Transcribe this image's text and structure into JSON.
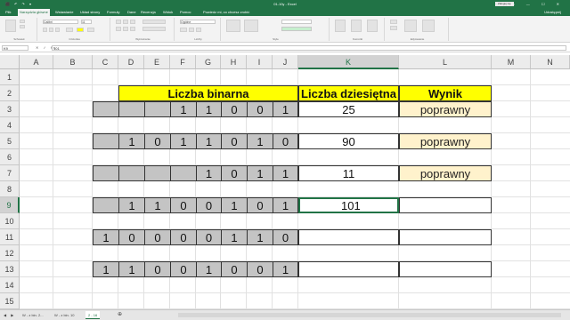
{
  "titlebar": {
    "qat": "⬛ ↶ ↷ ▾",
    "title": "01-10y - Excel",
    "signin": "Zaloguj się",
    "winbtns": "▭ — ☐ ✕"
  },
  "tabs": {
    "items": [
      "Plik",
      "Narzędzia główne",
      "Wstawianie",
      "Układ strony",
      "Formuły",
      "Dane",
      "Recenzja",
      "Widok",
      "Pomoc"
    ],
    "active_index": 1,
    "tellme": "Powiedz mi, co chcesz zrobić",
    "share": "Udostępnij"
  },
  "ribbon": {
    "groups": [
      "Schowek",
      "Czcionka",
      "Wyrównanie",
      "Liczby",
      "Style",
      "Komórki",
      "Edytowanie"
    ],
    "font_name": "Calibri",
    "font_size": "11",
    "number_format": "Ogólne",
    "cond_format": "Formatowanie warunkowe",
    "format_table": "Formatuj jako tabelę",
    "cell_styles": "Style komórki",
    "insert": "Wstaw",
    "delete": "Usuń",
    "format": "Format",
    "sum": "Σ",
    "sort": "Sortuj i filtruj",
    "find": "Znajdź i zaznacz"
  },
  "formula_bar": {
    "namebox": "K9",
    "fx": "✕ ✓ fx",
    "formula": "101"
  },
  "grid": {
    "columns": [
      "A",
      "B",
      "C",
      "D",
      "E",
      "F",
      "G",
      "H",
      "I",
      "J",
      "K",
      "L",
      "M",
      "N"
    ],
    "selected_column": "K",
    "rows": [
      "1",
      "2",
      "3",
      "4",
      "5",
      "6",
      "7",
      "8",
      "9",
      "10",
      "11",
      "12",
      "13",
      "14",
      "15"
    ],
    "selected_row": "9"
  },
  "sheet": {
    "header_binary": "Liczba binarna",
    "header_decimal": "Liczba dziesiętna",
    "header_result": "Wynik",
    "rows": [
      {
        "row": "3",
        "bits": [
          "",
          "",
          "",
          "1",
          "1",
          "0",
          "0",
          "1"
        ],
        "decimal": "25",
        "result": "poprawny"
      },
      {
        "row": "5",
        "bits": [
          "",
          "1",
          "0",
          "1",
          "1",
          "0",
          "1",
          "0"
        ],
        "decimal": "90",
        "result": "poprawny"
      },
      {
        "row": "7",
        "bits": [
          "",
          "",
          "",
          "",
          "1",
          "0",
          "1",
          "1"
        ],
        "decimal": "11",
        "result": "poprawny"
      },
      {
        "row": "9",
        "bits": [
          "",
          "1",
          "1",
          "0",
          "0",
          "1",
          "0",
          "1"
        ],
        "decimal": "101",
        "result": ""
      },
      {
        "row": "11",
        "bits": [
          "1",
          "0",
          "0",
          "0",
          "0",
          "1",
          "1",
          "0"
        ],
        "decimal": "",
        "result": ""
      },
      {
        "row": "13",
        "bits": [
          "1",
          "1",
          "0",
          "0",
          "1",
          "0",
          "0",
          "1"
        ],
        "decimal": "",
        "result": ""
      }
    ]
  },
  "sheetbar": {
    "nav": "◀ ▶",
    "tabs": [
      "W - z bin. 2...",
      "W - z bin. 10",
      "2 - 16"
    ],
    "active_index": 2,
    "add": "⊕"
  }
}
